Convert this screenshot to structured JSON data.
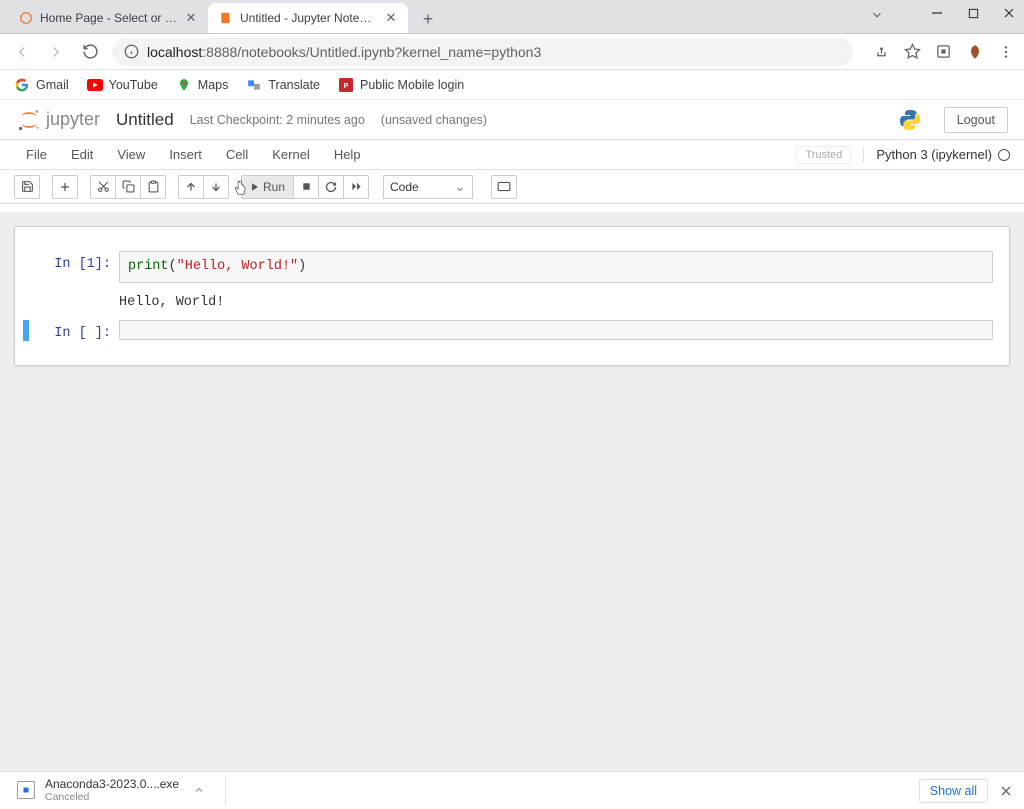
{
  "tabs": [
    {
      "title": "Home Page - Select or create a n"
    },
    {
      "title": "Untitled - Jupyter Notebook"
    }
  ],
  "url": {
    "host": "localhost",
    "rest": ":8888/notebooks/Untitled.ipynb?kernel_name=python3"
  },
  "bookmarks": [
    "Gmail",
    "YouTube",
    "Maps",
    "Translate",
    "Public Mobile login"
  ],
  "header": {
    "logo": "jupyter",
    "title": "Untitled",
    "checkpoint": "Last Checkpoint: 2 minutes ago",
    "unsaved": "(unsaved changes)",
    "logout": "Logout"
  },
  "menus": [
    "File",
    "Edit",
    "View",
    "Insert",
    "Cell",
    "Kernel",
    "Help"
  ],
  "trusted": "Trusted",
  "kernel": "Python 3 (ipykernel)",
  "toolbar": {
    "run": "Run",
    "cell_type": "Code"
  },
  "cells": [
    {
      "prompt": "In [1]:",
      "code_fn": "print",
      "code_open": "(",
      "code_str": "\"Hello, World!\"",
      "code_close": ")",
      "output": "Hello, World!"
    },
    {
      "prompt": "In [ ]:",
      "code": ""
    }
  ],
  "download": {
    "name": "Anaconda3-2023.0....exe",
    "status": "Canceled",
    "show_all": "Show all"
  }
}
